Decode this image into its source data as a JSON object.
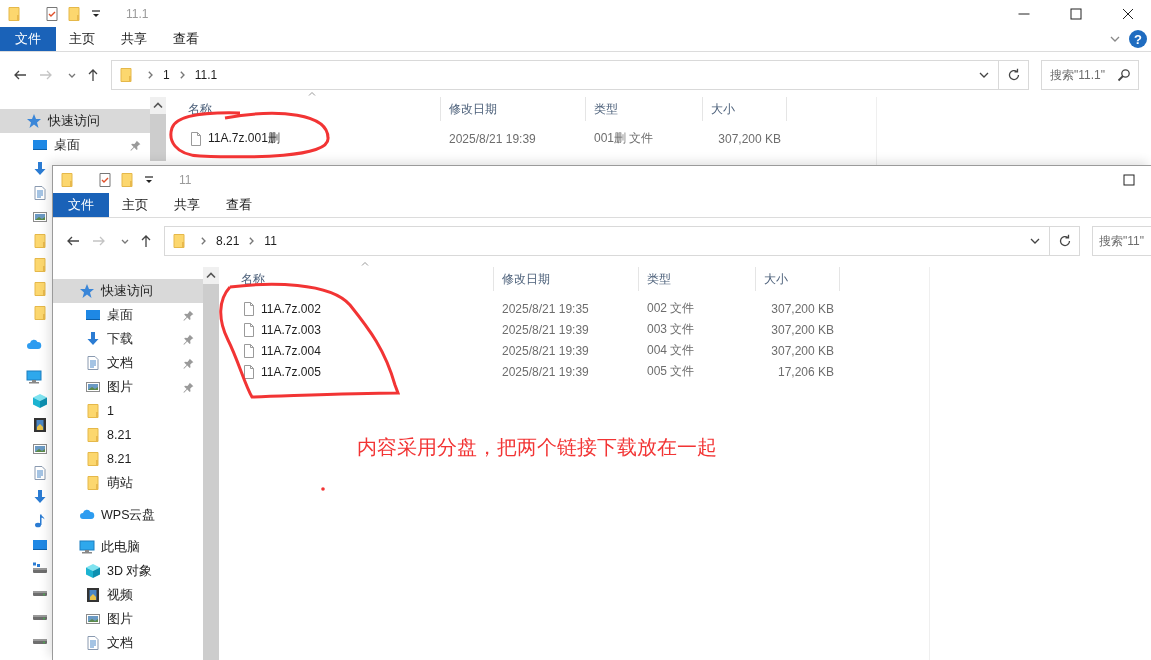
{
  "back_window": {
    "title": "11.1",
    "forward_enabled": false,
    "help": "?",
    "ribbon_tabs": [
      {
        "label": "文件",
        "selected": true
      },
      {
        "label": "主页",
        "selected": false
      },
      {
        "label": "共享",
        "selected": false
      },
      {
        "label": "查看",
        "selected": false
      }
    ],
    "breadcrumb": [
      "1",
      "11.1"
    ],
    "search": {
      "placeholder": "搜索\"11.1\""
    },
    "columns": [
      "名称",
      "修改日期",
      "类型",
      "大小"
    ],
    "files": [
      {
        "name": "11A.7z.001删",
        "modified": "2025/8/21 19:39",
        "type": "001删 文件",
        "size": "307,200 KB"
      }
    ],
    "sidebar": [
      {
        "kind": "quick_access",
        "label": "快速访问",
        "selected": true,
        "children": [
          {
            "kind": "desktop",
            "label": "桌面",
            "selected": false,
            "pinned": true
          },
          {
            "kind": "downloads",
            "selected": false
          },
          {
            "kind": "documents",
            "selected": false
          },
          {
            "kind": "pictures",
            "selected": false
          },
          {
            "kind": "folder",
            "selected": false
          },
          {
            "kind": "folder",
            "selected": false
          },
          {
            "kind": "folder",
            "selected": false
          },
          {
            "kind": "folder",
            "selected": false
          }
        ]
      },
      {
        "kind": "cloud",
        "selected": false
      },
      {
        "kind": "pc",
        "selected": false,
        "children": [
          {
            "kind": "objects3d",
            "selected": false
          },
          {
            "kind": "videos",
            "selected": false
          },
          {
            "kind": "pictures",
            "selected": false
          },
          {
            "kind": "documents",
            "selected": false
          },
          {
            "kind": "downloads",
            "selected": false
          },
          {
            "kind": "music",
            "selected": false
          },
          {
            "kind": "desktop",
            "selected": false
          },
          {
            "kind": "network_drive",
            "selected": false
          },
          {
            "kind": "drive",
            "selected": false
          },
          {
            "kind": "drive",
            "selected": false
          },
          {
            "kind": "drive",
            "selected": false
          }
        ]
      }
    ]
  },
  "front_window": {
    "title": "11",
    "forward_enabled": false,
    "ribbon_tabs": [
      {
        "label": "文件",
        "selected": true
      },
      {
        "label": "主页",
        "selected": false
      },
      {
        "label": "共享",
        "selected": false
      },
      {
        "label": "查看",
        "selected": false
      }
    ],
    "breadcrumb": [
      "8.21",
      "11"
    ],
    "search": {
      "placeholder": "搜索\"11\""
    },
    "columns": [
      "名称",
      "修改日期",
      "类型",
      "大小"
    ],
    "files": [
      {
        "name": "11A.7z.002",
        "modified": "2025/8/21 19:35",
        "type": "002 文件",
        "size": "307,200 KB"
      },
      {
        "name": "11A.7z.003",
        "modified": "2025/8/21 19:39",
        "type": "003 文件",
        "size": "307,200 KB"
      },
      {
        "name": "11A.7z.004",
        "modified": "2025/8/21 19:39",
        "type": "004 文件",
        "size": "307,200 KB"
      },
      {
        "name": "11A.7z.005",
        "modified": "2025/8/21 19:39",
        "type": "005 文件",
        "size": "17,206 KB"
      }
    ],
    "sidebar": [
      {
        "kind": "quick_access",
        "label": "快速访问",
        "selected": true,
        "children": [
          {
            "kind": "desktop",
            "label": "桌面",
            "selected": false,
            "pinned": true
          },
          {
            "kind": "downloads",
            "label": "下载",
            "selected": false,
            "pinned": true
          },
          {
            "kind": "documents",
            "label": "文档",
            "selected": false,
            "pinned": true
          },
          {
            "kind": "pictures",
            "label": "图片",
            "selected": false,
            "pinned": true
          },
          {
            "kind": "folder",
            "label": "1",
            "selected": false,
            "pinned": false
          },
          {
            "kind": "folder",
            "label": "8.21",
            "selected": false,
            "pinned": false
          },
          {
            "kind": "folder",
            "label": "8.21",
            "selected": false,
            "pinned": false
          },
          {
            "kind": "folder",
            "label": "萌站",
            "selected": false,
            "pinned": false
          }
        ]
      },
      {
        "kind": "cloud",
        "label": "WPS云盘",
        "selected": false
      },
      {
        "kind": "pc",
        "label": "此电脑",
        "selected": false,
        "children": [
          {
            "kind": "objects3d",
            "label": "3D 对象",
            "selected": false
          },
          {
            "kind": "videos",
            "label": "视频",
            "selected": false
          },
          {
            "kind": "pictures",
            "label": "图片",
            "selected": false
          },
          {
            "kind": "documents",
            "label": "文档",
            "selected": false
          }
        ]
      }
    ]
  },
  "annotation": {
    "text": "内容采用分盘，把两个链接下载放在一起"
  }
}
